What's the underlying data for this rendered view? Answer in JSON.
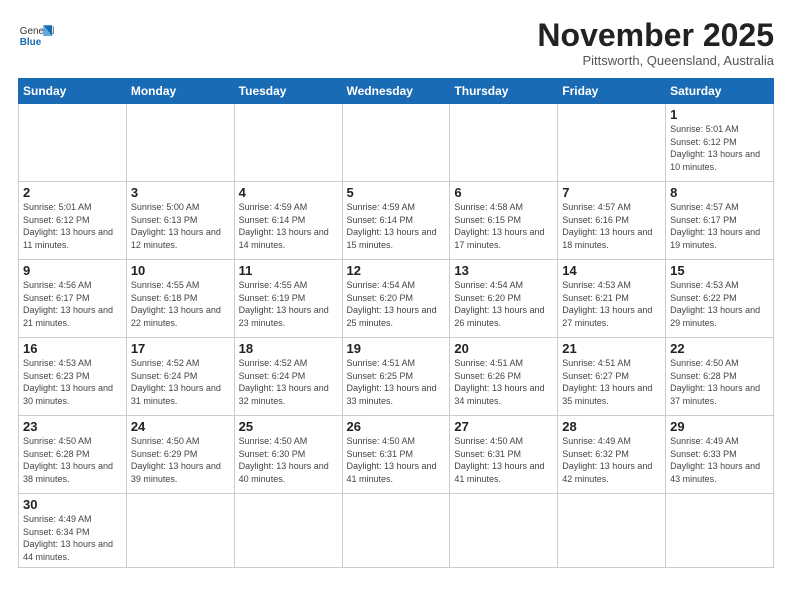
{
  "header": {
    "logo_general": "General",
    "logo_blue": "Blue",
    "month": "November 2025",
    "location": "Pittsworth, Queensland, Australia"
  },
  "days_of_week": [
    "Sunday",
    "Monday",
    "Tuesday",
    "Wednesday",
    "Thursday",
    "Friday",
    "Saturday"
  ],
  "weeks": [
    [
      {
        "day": "",
        "info": ""
      },
      {
        "day": "",
        "info": ""
      },
      {
        "day": "",
        "info": ""
      },
      {
        "day": "",
        "info": ""
      },
      {
        "day": "",
        "info": ""
      },
      {
        "day": "",
        "info": ""
      },
      {
        "day": "1",
        "info": "Sunrise: 5:01 AM\nSunset: 6:12 PM\nDaylight: 13 hours\nand 10 minutes."
      }
    ],
    [
      {
        "day": "2",
        "info": "Sunrise: 5:01 AM\nSunset: 6:12 PM\nDaylight: 13 hours\nand 11 minutes."
      },
      {
        "day": "3",
        "info": "Sunrise: 5:00 AM\nSunset: 6:13 PM\nDaylight: 13 hours\nand 12 minutes."
      },
      {
        "day": "4",
        "info": "Sunrise: 4:59 AM\nSunset: 6:14 PM\nDaylight: 13 hours\nand 14 minutes."
      },
      {
        "day": "5",
        "info": "Sunrise: 4:59 AM\nSunset: 6:14 PM\nDaylight: 13 hours\nand 15 minutes."
      },
      {
        "day": "6",
        "info": "Sunrise: 4:58 AM\nSunset: 6:15 PM\nDaylight: 13 hours\nand 17 minutes."
      },
      {
        "day": "7",
        "info": "Sunrise: 4:57 AM\nSunset: 6:16 PM\nDaylight: 13 hours\nand 18 minutes."
      },
      {
        "day": "8",
        "info": "Sunrise: 4:57 AM\nSunset: 6:17 PM\nDaylight: 13 hours\nand 19 minutes."
      }
    ],
    [
      {
        "day": "9",
        "info": "Sunrise: 4:56 AM\nSunset: 6:17 PM\nDaylight: 13 hours\nand 21 minutes."
      },
      {
        "day": "10",
        "info": "Sunrise: 4:55 AM\nSunset: 6:18 PM\nDaylight: 13 hours\nand 22 minutes."
      },
      {
        "day": "11",
        "info": "Sunrise: 4:55 AM\nSunset: 6:19 PM\nDaylight: 13 hours\nand 23 minutes."
      },
      {
        "day": "12",
        "info": "Sunrise: 4:54 AM\nSunset: 6:20 PM\nDaylight: 13 hours\nand 25 minutes."
      },
      {
        "day": "13",
        "info": "Sunrise: 4:54 AM\nSunset: 6:20 PM\nDaylight: 13 hours\nand 26 minutes."
      },
      {
        "day": "14",
        "info": "Sunrise: 4:53 AM\nSunset: 6:21 PM\nDaylight: 13 hours\nand 27 minutes."
      },
      {
        "day": "15",
        "info": "Sunrise: 4:53 AM\nSunset: 6:22 PM\nDaylight: 13 hours\nand 29 minutes."
      }
    ],
    [
      {
        "day": "16",
        "info": "Sunrise: 4:53 AM\nSunset: 6:23 PM\nDaylight: 13 hours\nand 30 minutes."
      },
      {
        "day": "17",
        "info": "Sunrise: 4:52 AM\nSunset: 6:24 PM\nDaylight: 13 hours\nand 31 minutes."
      },
      {
        "day": "18",
        "info": "Sunrise: 4:52 AM\nSunset: 6:24 PM\nDaylight: 13 hours\nand 32 minutes."
      },
      {
        "day": "19",
        "info": "Sunrise: 4:51 AM\nSunset: 6:25 PM\nDaylight: 13 hours\nand 33 minutes."
      },
      {
        "day": "20",
        "info": "Sunrise: 4:51 AM\nSunset: 6:26 PM\nDaylight: 13 hours\nand 34 minutes."
      },
      {
        "day": "21",
        "info": "Sunrise: 4:51 AM\nSunset: 6:27 PM\nDaylight: 13 hours\nand 35 minutes."
      },
      {
        "day": "22",
        "info": "Sunrise: 4:50 AM\nSunset: 6:28 PM\nDaylight: 13 hours\nand 37 minutes."
      }
    ],
    [
      {
        "day": "23",
        "info": "Sunrise: 4:50 AM\nSunset: 6:28 PM\nDaylight: 13 hours\nand 38 minutes."
      },
      {
        "day": "24",
        "info": "Sunrise: 4:50 AM\nSunset: 6:29 PM\nDaylight: 13 hours\nand 39 minutes."
      },
      {
        "day": "25",
        "info": "Sunrise: 4:50 AM\nSunset: 6:30 PM\nDaylight: 13 hours\nand 40 minutes."
      },
      {
        "day": "26",
        "info": "Sunrise: 4:50 AM\nSunset: 6:31 PM\nDaylight: 13 hours\nand 41 minutes."
      },
      {
        "day": "27",
        "info": "Sunrise: 4:50 AM\nSunset: 6:31 PM\nDaylight: 13 hours\nand 41 minutes."
      },
      {
        "day": "28",
        "info": "Sunrise: 4:49 AM\nSunset: 6:32 PM\nDaylight: 13 hours\nand 42 minutes."
      },
      {
        "day": "29",
        "info": "Sunrise: 4:49 AM\nSunset: 6:33 PM\nDaylight: 13 hours\nand 43 minutes."
      }
    ],
    [
      {
        "day": "30",
        "info": "Sunrise: 4:49 AM\nSunset: 6:34 PM\nDaylight: 13 hours\nand 44 minutes."
      },
      {
        "day": "",
        "info": ""
      },
      {
        "day": "",
        "info": ""
      },
      {
        "day": "",
        "info": ""
      },
      {
        "day": "",
        "info": ""
      },
      {
        "day": "",
        "info": ""
      },
      {
        "day": "",
        "info": ""
      }
    ]
  ]
}
